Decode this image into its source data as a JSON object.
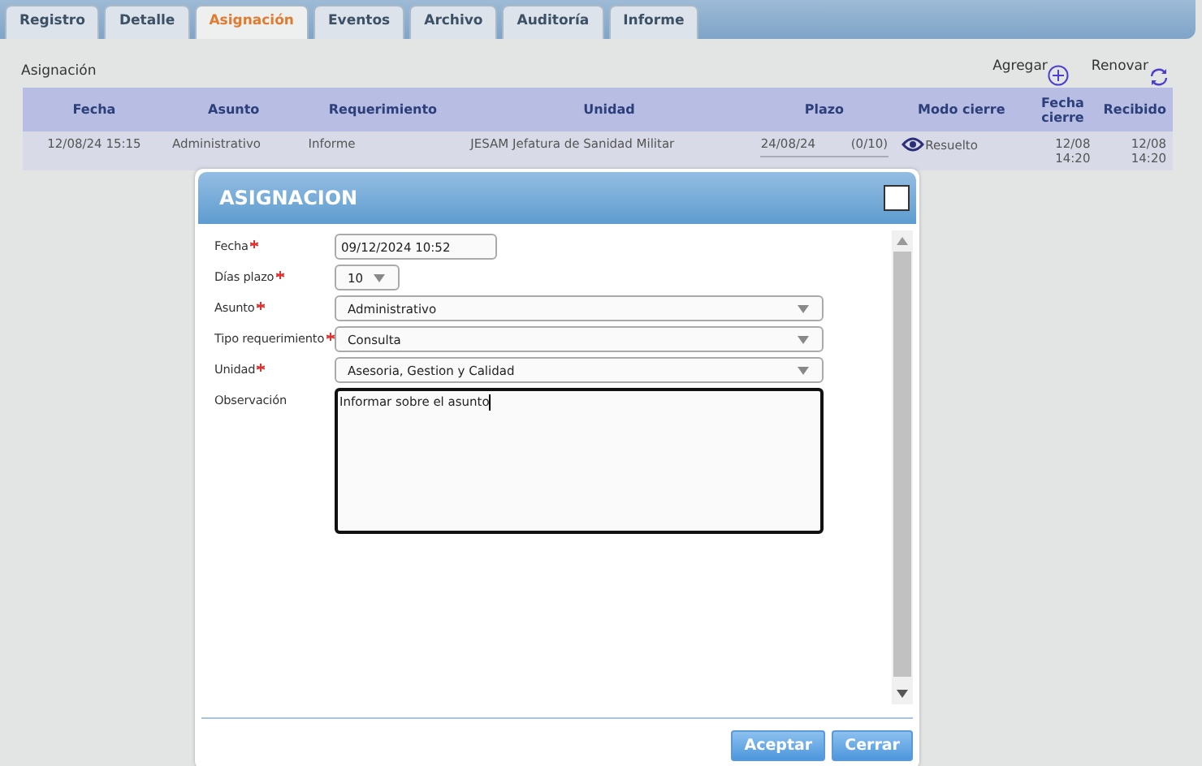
{
  "tabs": [
    {
      "label": "Registro",
      "selected": false
    },
    {
      "label": "Detalle",
      "selected": false
    },
    {
      "label": "Asignación",
      "selected": true
    },
    {
      "label": "Eventos",
      "selected": false
    },
    {
      "label": "Archivo",
      "selected": false
    },
    {
      "label": "Auditoría",
      "selected": false
    },
    {
      "label": "Informe",
      "selected": false
    }
  ],
  "section": {
    "title": "Asignación",
    "actions": [
      {
        "label": "Agregar",
        "kind": "add"
      },
      {
        "label": "Renovar",
        "kind": "refresh"
      }
    ]
  },
  "table": {
    "columns": [
      "Fecha",
      "Asunto",
      "Requerimiento",
      "Unidad",
      "Plazo",
      "Modo cierre",
      "Fecha cierre",
      "Recibido"
    ],
    "rows": [
      {
        "fecha": "12/08/24 15:15",
        "asunto": "Administrativo",
        "requerimiento": "Informe",
        "unidad": "JESAM Jefatura de Sanidad Militar",
        "plazo": "24/08/24",
        "plazo_count": "(0/10)",
        "modo_cierre": "Resuelto",
        "fecha_cierre": "12/08 14:20",
        "recibido": "12/08 14:20"
      }
    ]
  },
  "dialog": {
    "title": "ASIGNACION",
    "fields": [
      {
        "label": "Fecha",
        "required": true,
        "kind": "text",
        "value": "09/12/2024 10:52"
      },
      {
        "label": "Días plazo",
        "required": true,
        "kind": "short-select",
        "value": "10"
      },
      {
        "label": "Asunto",
        "required": true,
        "kind": "select",
        "value": "Administrativo"
      },
      {
        "label": "Tipo requerimiento",
        "required": true,
        "kind": "select",
        "value": "Consulta"
      },
      {
        "label": "Unidad",
        "required": true,
        "kind": "select",
        "value": "Asesoria, Gestion y Calidad"
      },
      {
        "label": "Observación",
        "required": false,
        "kind": "textarea",
        "value": "Informar sobre el asunto "
      }
    ],
    "buttons": [
      "Aceptar",
      "Cerrar"
    ]
  }
}
